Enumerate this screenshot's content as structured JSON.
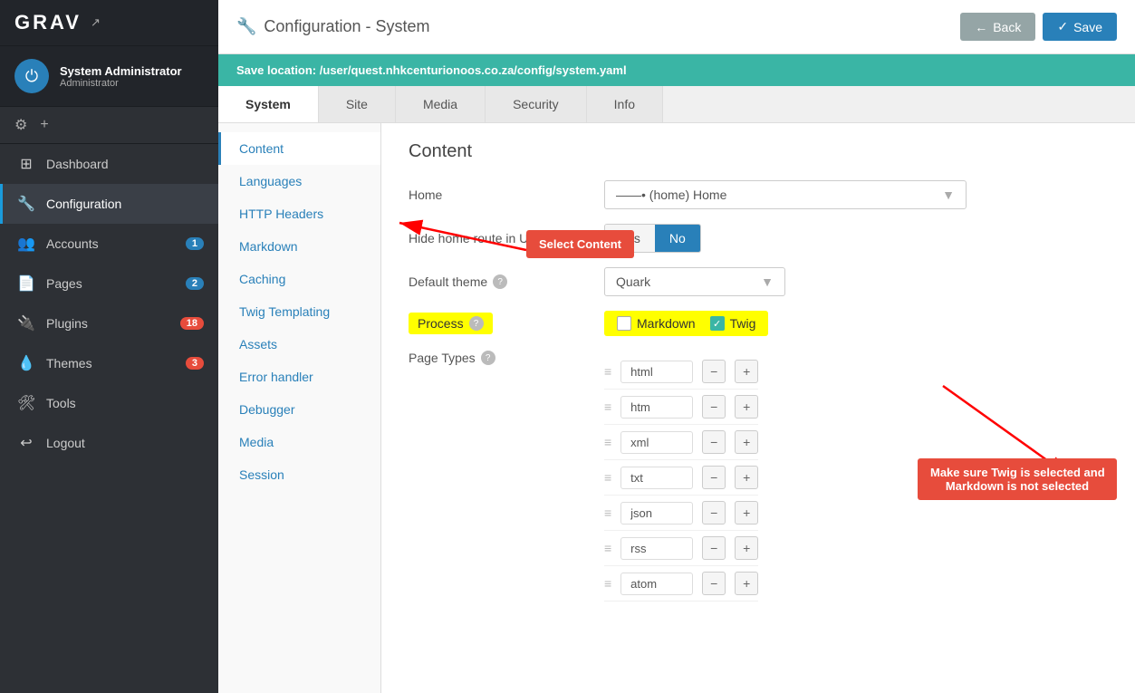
{
  "sidebar": {
    "logo": "GRAV",
    "logo_external_icon": "↗",
    "user": {
      "name": "System Administrator",
      "role": "Administrator"
    },
    "nav_items": [
      {
        "id": "dashboard",
        "icon": "⊞",
        "label": "Dashboard",
        "badge": null,
        "active": false
      },
      {
        "id": "configuration",
        "icon": "🔧",
        "label": "Configuration",
        "badge": null,
        "active": true
      },
      {
        "id": "accounts",
        "icon": "👥",
        "label": "Accounts",
        "badge": "1",
        "active": false
      },
      {
        "id": "pages",
        "icon": "📄",
        "label": "Pages",
        "badge": "2",
        "active": false
      },
      {
        "id": "plugins",
        "icon": "🔌",
        "label": "Plugins",
        "badge": "18",
        "active": false
      },
      {
        "id": "themes",
        "icon": "💧",
        "label": "Themes",
        "badge": "3",
        "active": false
      },
      {
        "id": "tools",
        "icon": "🛠",
        "label": "Tools",
        "badge": null,
        "active": false
      },
      {
        "id": "logout",
        "icon": "↩",
        "label": "Logout",
        "badge": null,
        "active": false
      }
    ]
  },
  "topbar": {
    "title": "Configuration - System",
    "title_icon": "🔧",
    "back_label": "Back",
    "save_label": "Save"
  },
  "save_location": {
    "prefix": "Save location:",
    "path": "/user/quest.nhkcenturionoos.co.za/config/system.yaml"
  },
  "tabs": [
    {
      "id": "system",
      "label": "System",
      "active": true
    },
    {
      "id": "site",
      "label": "Site",
      "active": false
    },
    {
      "id": "media",
      "label": "Media",
      "active": false
    },
    {
      "id": "security",
      "label": "Security",
      "active": false
    },
    {
      "id": "info",
      "label": "Info",
      "active": false
    }
  ],
  "left_nav": [
    {
      "id": "content",
      "label": "Content",
      "active": true
    },
    {
      "id": "languages",
      "label": "Languages",
      "active": false
    },
    {
      "id": "http_headers",
      "label": "HTTP Headers",
      "active": false
    },
    {
      "id": "markdown",
      "label": "Markdown",
      "active": false
    },
    {
      "id": "caching",
      "label": "Caching",
      "active": false
    },
    {
      "id": "twig_templating",
      "label": "Twig Templating",
      "active": false
    },
    {
      "id": "assets",
      "label": "Assets",
      "active": false
    },
    {
      "id": "error_handler",
      "label": "Error handler",
      "active": false
    },
    {
      "id": "debugger",
      "label": "Debugger",
      "active": false
    },
    {
      "id": "media",
      "label": "Media",
      "active": false
    },
    {
      "id": "session",
      "label": "Session",
      "active": false
    }
  ],
  "content_section": {
    "title": "Content",
    "home_label": "Home",
    "home_dropdown_value": "——• (home) Home",
    "hide_home_route_label": "Hide home route in URLs",
    "hide_home_yes": "Yes",
    "hide_home_no": "No",
    "default_theme_label": "Default theme",
    "default_theme_value": "Quark",
    "process_label": "Process",
    "markdown_label": "Markdown",
    "twig_label": "Twig",
    "page_types_label": "Page Types",
    "page_types": [
      {
        "value": "html"
      },
      {
        "value": "htm"
      },
      {
        "value": "xml"
      },
      {
        "value": "txt"
      },
      {
        "value": "json"
      },
      {
        "value": "rss"
      },
      {
        "value": "atom"
      }
    ]
  },
  "annotations": {
    "select_content": "Select Content",
    "twig_note_line1": "Make sure Twig is selected and",
    "twig_note_line2": "Markdown is not selected"
  }
}
